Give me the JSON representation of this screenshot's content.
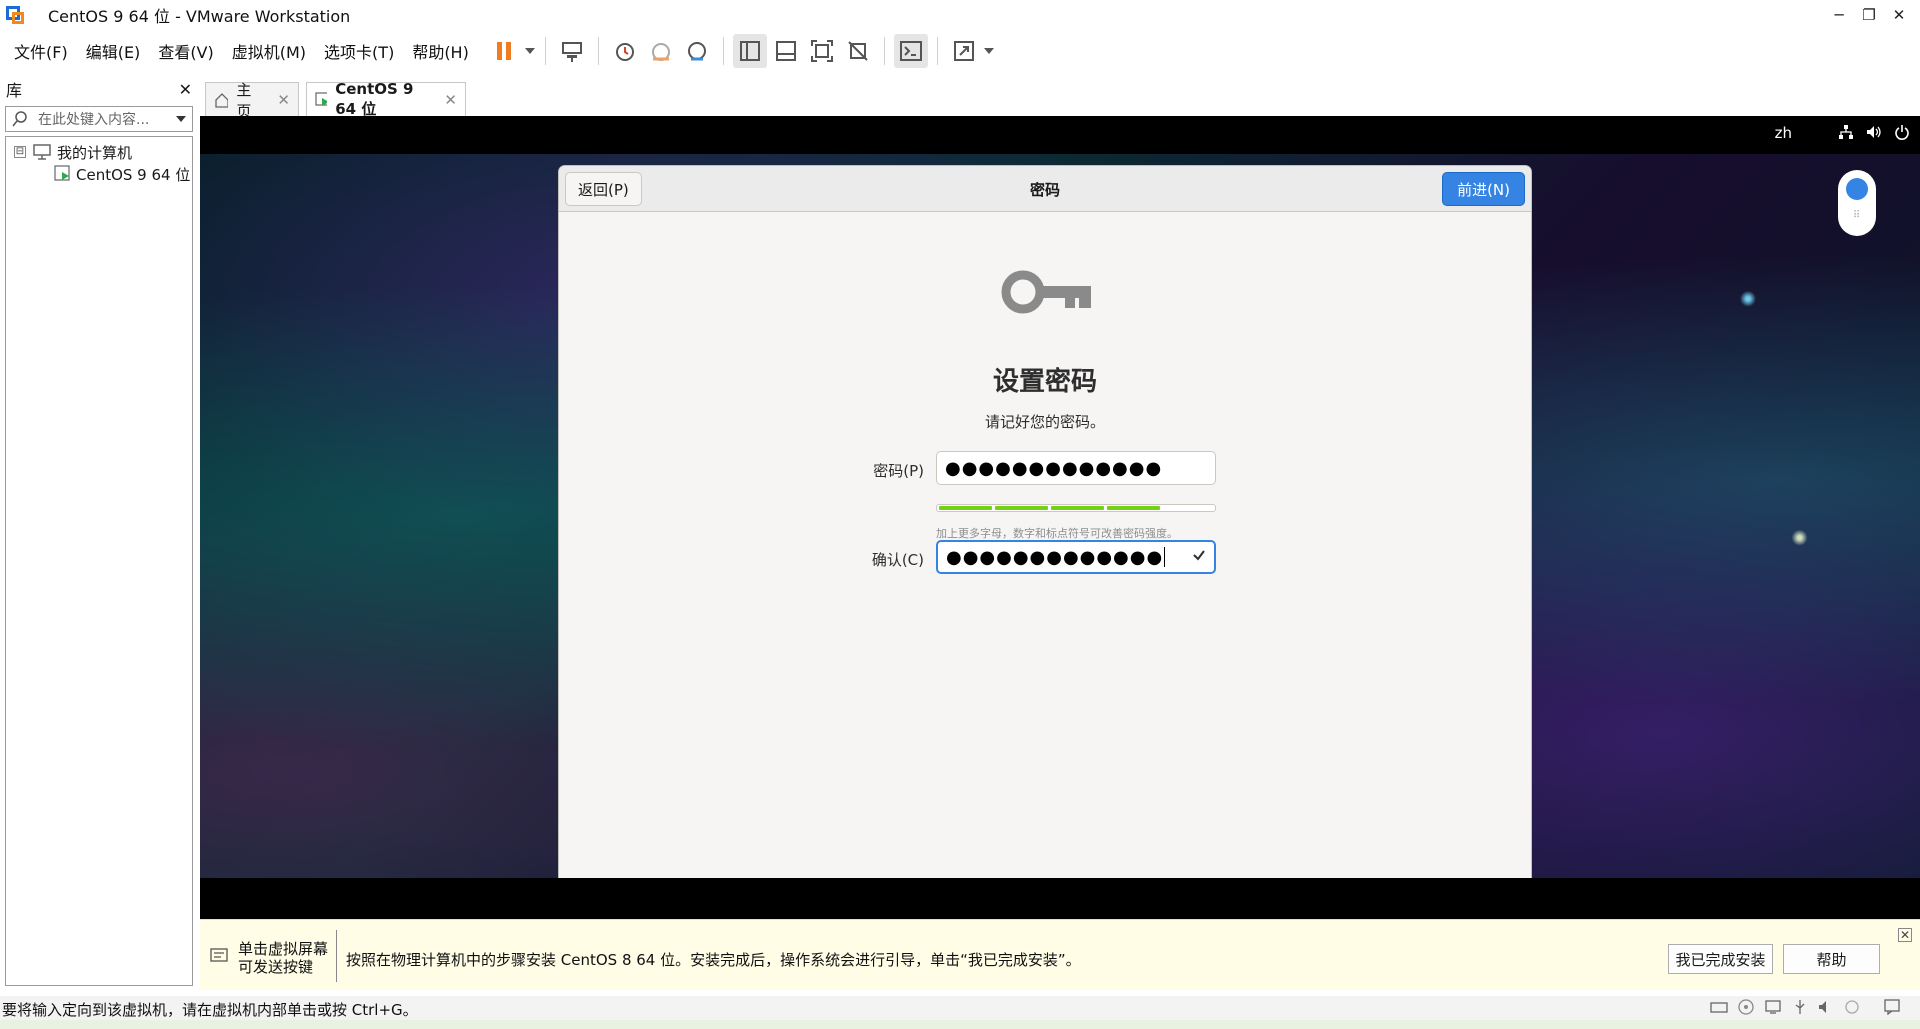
{
  "window": {
    "title": "CentOS 9 64 位 - VMware Workstation",
    "controls": [
      "─",
      "❐",
      "✕"
    ]
  },
  "menu": {
    "items": [
      "文件(F)",
      "编辑(E)",
      "查看(V)",
      "虚拟机(M)",
      "选项卡(T)",
      "帮助(H)"
    ]
  },
  "toolbar": {
    "icons": [
      "pause-icon",
      "send-ctrl-alt-del-icon",
      "snapshot-icon",
      "revert-snapshot-icon",
      "snapshot-manager-icon",
      "library-view-icon",
      "thumbnail-view-icon",
      "fullscreen-icon",
      "unity-icon",
      "console-icon",
      "stretch-icon"
    ],
    "pause_color": "#f07c21"
  },
  "library": {
    "title": "库",
    "close": "✕",
    "search_placeholder": "在此处键入内容...",
    "tree": {
      "root": "我的计算机",
      "toggle": "⊟",
      "child": "CentOS 9 64 位"
    }
  },
  "tabs": [
    {
      "label": "主页",
      "close": "✕"
    },
    {
      "label": "CentOS 9 64 位",
      "close": "✕"
    }
  ],
  "gnome": {
    "lang": "zh"
  },
  "installer": {
    "back_label": "返回(P)",
    "header_title": "密码",
    "next_label": "前进(N)",
    "heading": "设置密码",
    "subheading": "请记好您的密码。",
    "password_label": "密码(P)",
    "password_value": "●●●●●●●●●●●●●",
    "strength_hint": "加上更多字母，数字和标点符号可改善密码强度。",
    "strength_level": 0.8,
    "confirm_label": "确认(C)",
    "confirm_value": "●●●●●●●●●●●●●",
    "accent": "#3584e4"
  },
  "infobar": {
    "click_hint_line1": "单击虚拟屏幕",
    "click_hint_line2": "可发送按键",
    "message": "按照在物理计算机中的步骤安装 CentOS 8 64 位。安装完成后，操作系统会进行引导，单击“我已完成安装”。",
    "done_label": "我已完成安装",
    "help_label": "帮助",
    "close": "✕"
  },
  "statusbar": {
    "text": "要将输入定向到该虚拟机，请在虚拟机内部单击或按 Ctrl+G。"
  }
}
